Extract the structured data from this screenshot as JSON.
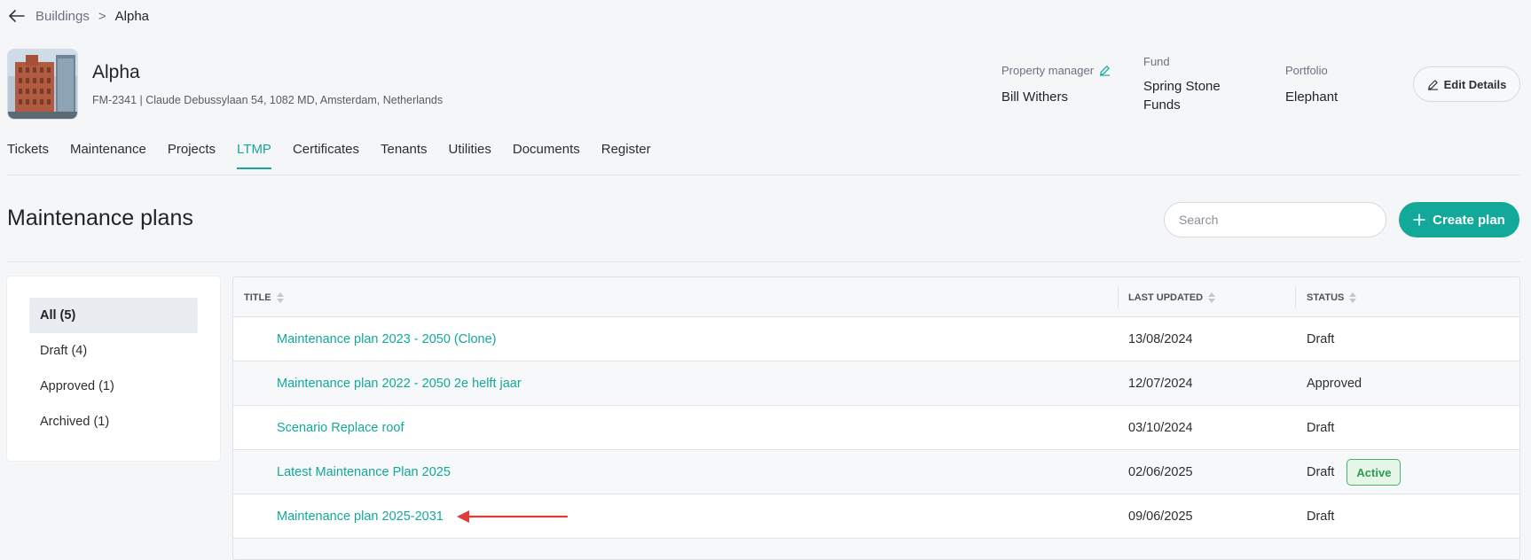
{
  "breadcrumb": {
    "parent": "Buildings",
    "separator": ">",
    "current": "Alpha"
  },
  "building": {
    "name": "Alpha",
    "address": "FM-2341 | Claude Debussylaan 54, 1082 MD, Amsterdam, Netherlands"
  },
  "meta": {
    "property_manager_label": "Property manager",
    "property_manager": "Bill Withers",
    "fund_label": "Fund",
    "fund": "Spring Stone Funds",
    "portfolio_label": "Portfolio",
    "portfolio": "Elephant"
  },
  "edit_button": "Edit Details",
  "tabs": [
    {
      "label": "Tickets",
      "active": false
    },
    {
      "label": "Maintenance",
      "active": false
    },
    {
      "label": "Projects",
      "active": false
    },
    {
      "label": "LTMP",
      "active": true
    },
    {
      "label": "Certificates",
      "active": false
    },
    {
      "label": "Tenants",
      "active": false
    },
    {
      "label": "Utilities",
      "active": false
    },
    {
      "label": "Documents",
      "active": false
    },
    {
      "label": "Register",
      "active": false
    }
  ],
  "section": {
    "title": "Maintenance plans",
    "search_placeholder": "Search",
    "search_value": "",
    "create_button": "Create plan"
  },
  "filters": [
    {
      "label": "All (5)",
      "selected": true
    },
    {
      "label": "Draft (4)",
      "selected": false
    },
    {
      "label": "Approved (1)",
      "selected": false
    },
    {
      "label": "Archived (1)",
      "selected": false
    }
  ],
  "table": {
    "columns": [
      "TITLE",
      "LAST UPDATED",
      "STATUS"
    ],
    "rows": [
      {
        "title": "Maintenance plan 2023 - 2050 (Clone)",
        "updated": "13/08/2024",
        "status": "Draft",
        "badge": ""
      },
      {
        "title": "Maintenance plan 2022 - 2050 2e helft jaar",
        "updated": "12/07/2024",
        "status": "Approved",
        "badge": ""
      },
      {
        "title": "Scenario Replace roof",
        "updated": "03/10/2024",
        "status": "Draft",
        "badge": ""
      },
      {
        "title": "Latest Maintenance Plan 2025",
        "updated": "02/06/2025",
        "status": "Draft",
        "badge": "Active"
      },
      {
        "title": "Maintenance plan 2025-2031",
        "updated": "09/06/2025",
        "status": "Draft",
        "badge": ""
      }
    ]
  },
  "colors": {
    "accent": "#12a89a",
    "arrow": "#e03a3a",
    "badge_green": "#2d9c4f"
  }
}
